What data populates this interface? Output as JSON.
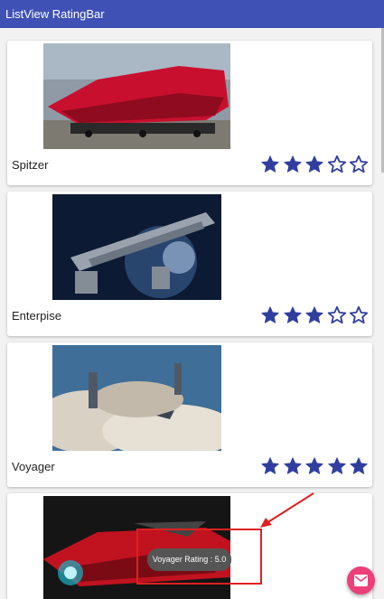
{
  "app": {
    "title": "ListView RatingBar"
  },
  "colors": {
    "primary": "#3f51b5",
    "star": "#303f9f",
    "accent": "#ec407a",
    "annotation": "#e02020"
  },
  "items": [
    {
      "name": "Spitzer",
      "rating": 3,
      "max": 5,
      "image": "red-spaceship-photo"
    },
    {
      "name": "Enterpise",
      "rating": 3,
      "max": 5,
      "image": "space-station-photo"
    },
    {
      "name": "Voyager",
      "rating": 5,
      "max": 5,
      "image": "cloud-city-photo"
    },
    {
      "name": "",
      "rating": null,
      "max": 5,
      "image": "red-racer-photo"
    }
  ],
  "toast": {
    "text": "Voyager Rating : 5.0"
  },
  "fab": {
    "icon": "email-icon"
  }
}
